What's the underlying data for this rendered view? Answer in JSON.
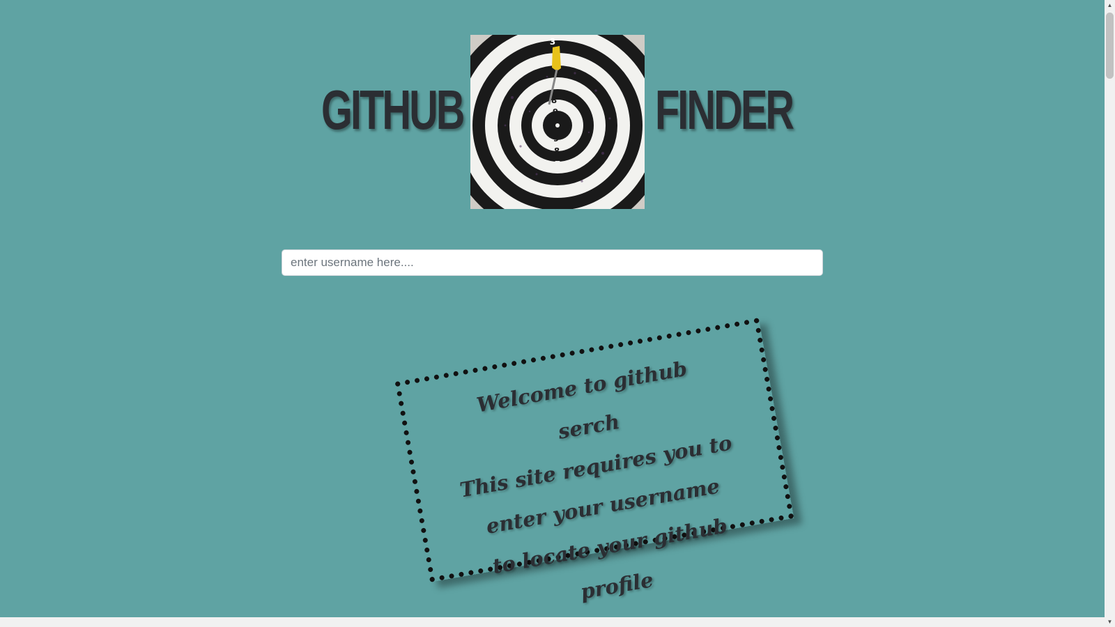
{
  "header": {
    "title_left": "GITHUB",
    "title_right": "FINDER",
    "logo_icon": "dartboard-target-icon"
  },
  "search": {
    "placeholder": "enter username here...."
  },
  "welcome": {
    "lines": [
      "Welcome to github serch",
      "This site requires you to",
      "enter your username",
      "to locate your github",
      "profile"
    ]
  },
  "colors": {
    "background": "#5fa3a3",
    "title_text": "#2b2e33",
    "card_border": "#111111"
  }
}
